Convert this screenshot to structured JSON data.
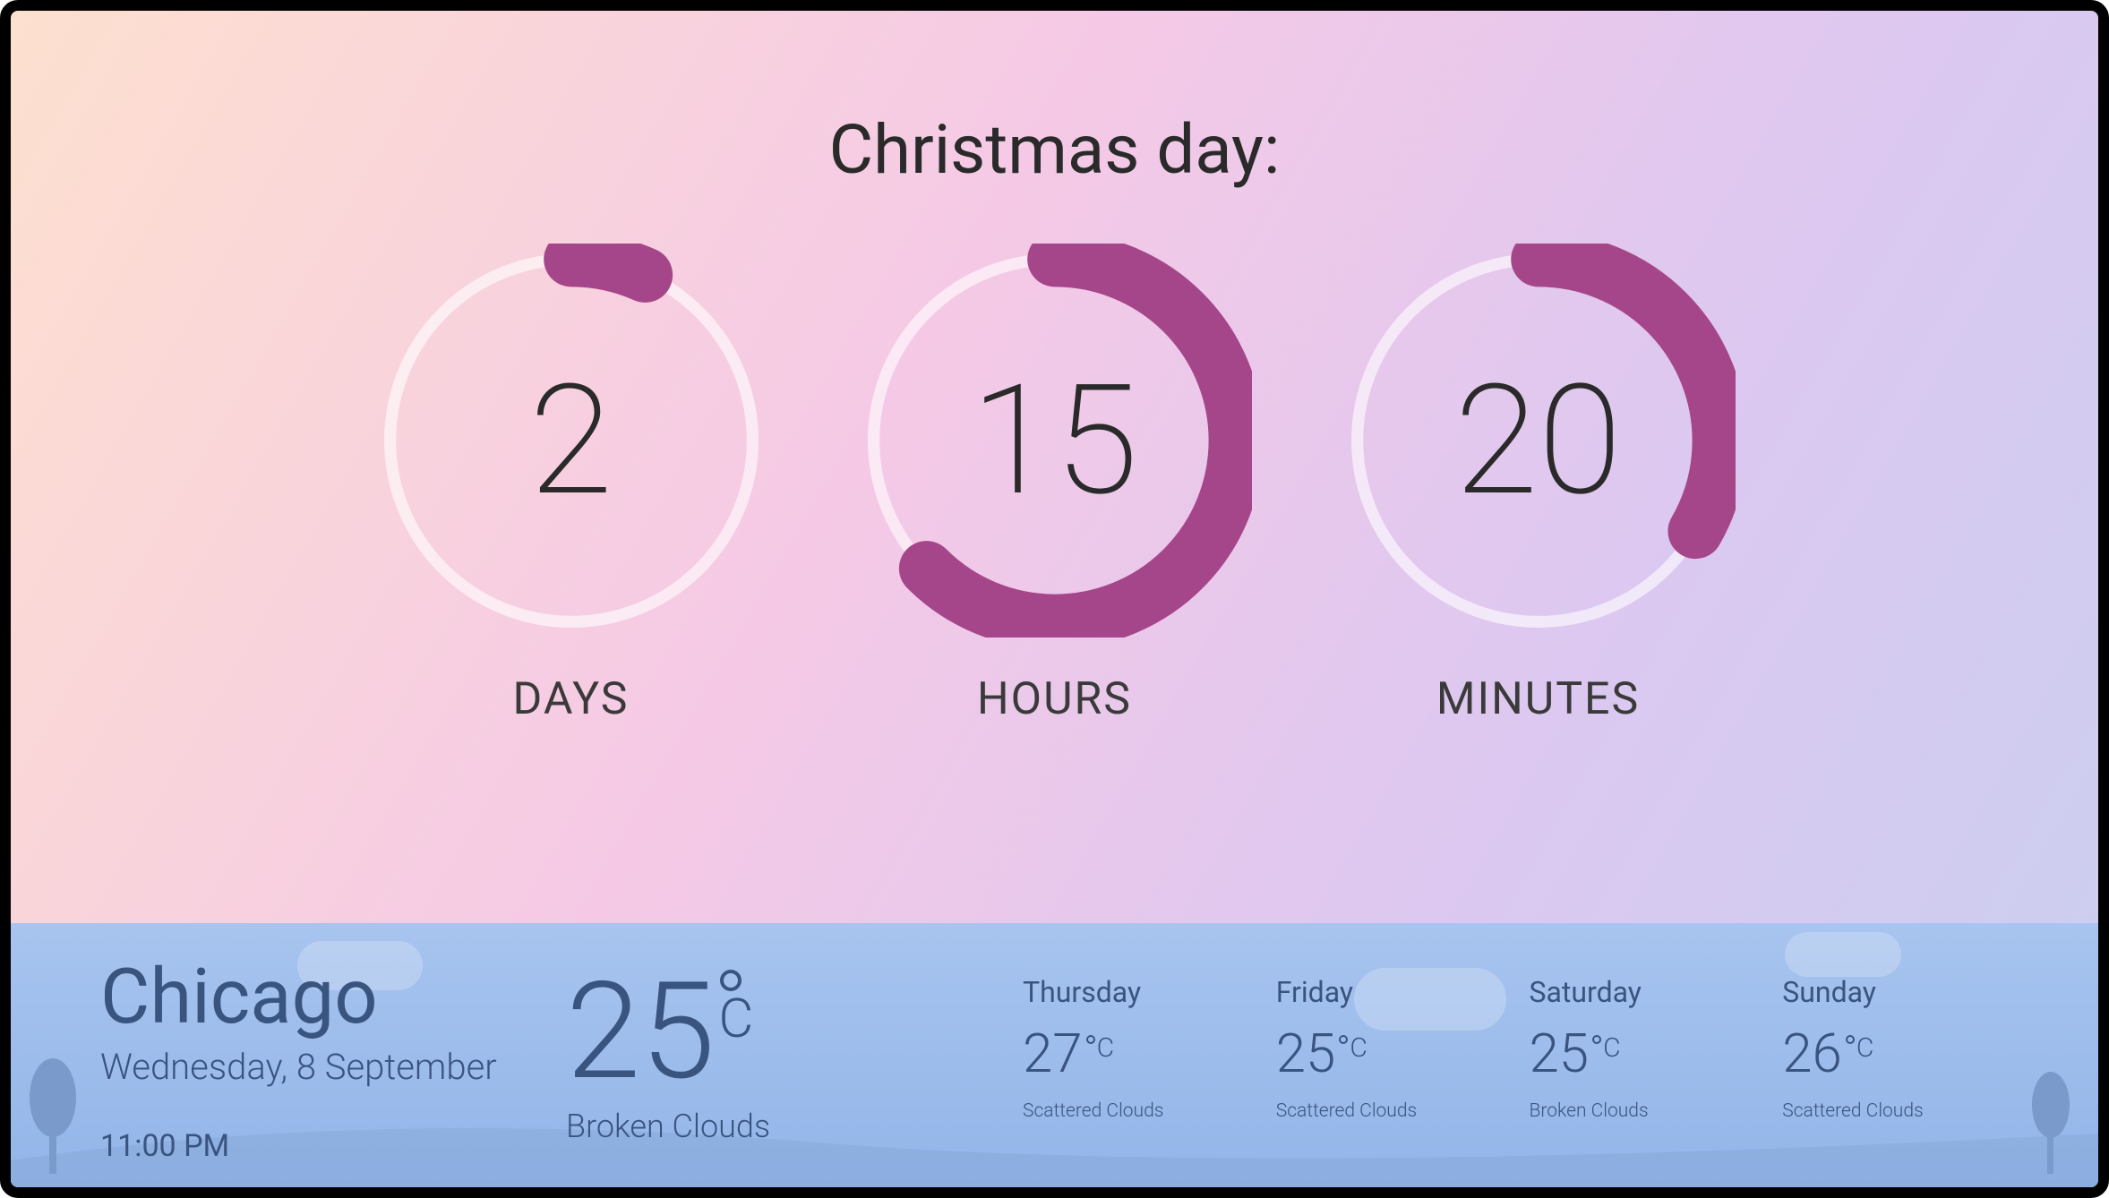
{
  "countdown": {
    "title": "Christmas day:",
    "accent_color": "#a6468a",
    "units": [
      {
        "label": "DAYS",
        "value": "2",
        "max": 30
      },
      {
        "label": "HOURS",
        "value": "15",
        "max": 24
      },
      {
        "label": "MINUTES",
        "value": "20",
        "max": 60
      }
    ]
  },
  "weather": {
    "city": "Chicago",
    "date": "Wednesday, 8 September",
    "time": "11:00 PM",
    "current": {
      "temp": "25",
      "unit": "C",
      "condition": "Broken Clouds"
    },
    "forecast": [
      {
        "day": "Thursday",
        "temp": "27",
        "unit": "C",
        "condition": "Scattered Clouds"
      },
      {
        "day": "Friday",
        "temp": "25",
        "unit": "C",
        "condition": "Scattered Clouds"
      },
      {
        "day": "Saturday",
        "temp": "25",
        "unit": "C",
        "condition": "Broken Clouds"
      },
      {
        "day": "Sunday",
        "temp": "26",
        "unit": "C",
        "condition": "Scattered Clouds"
      }
    ]
  }
}
